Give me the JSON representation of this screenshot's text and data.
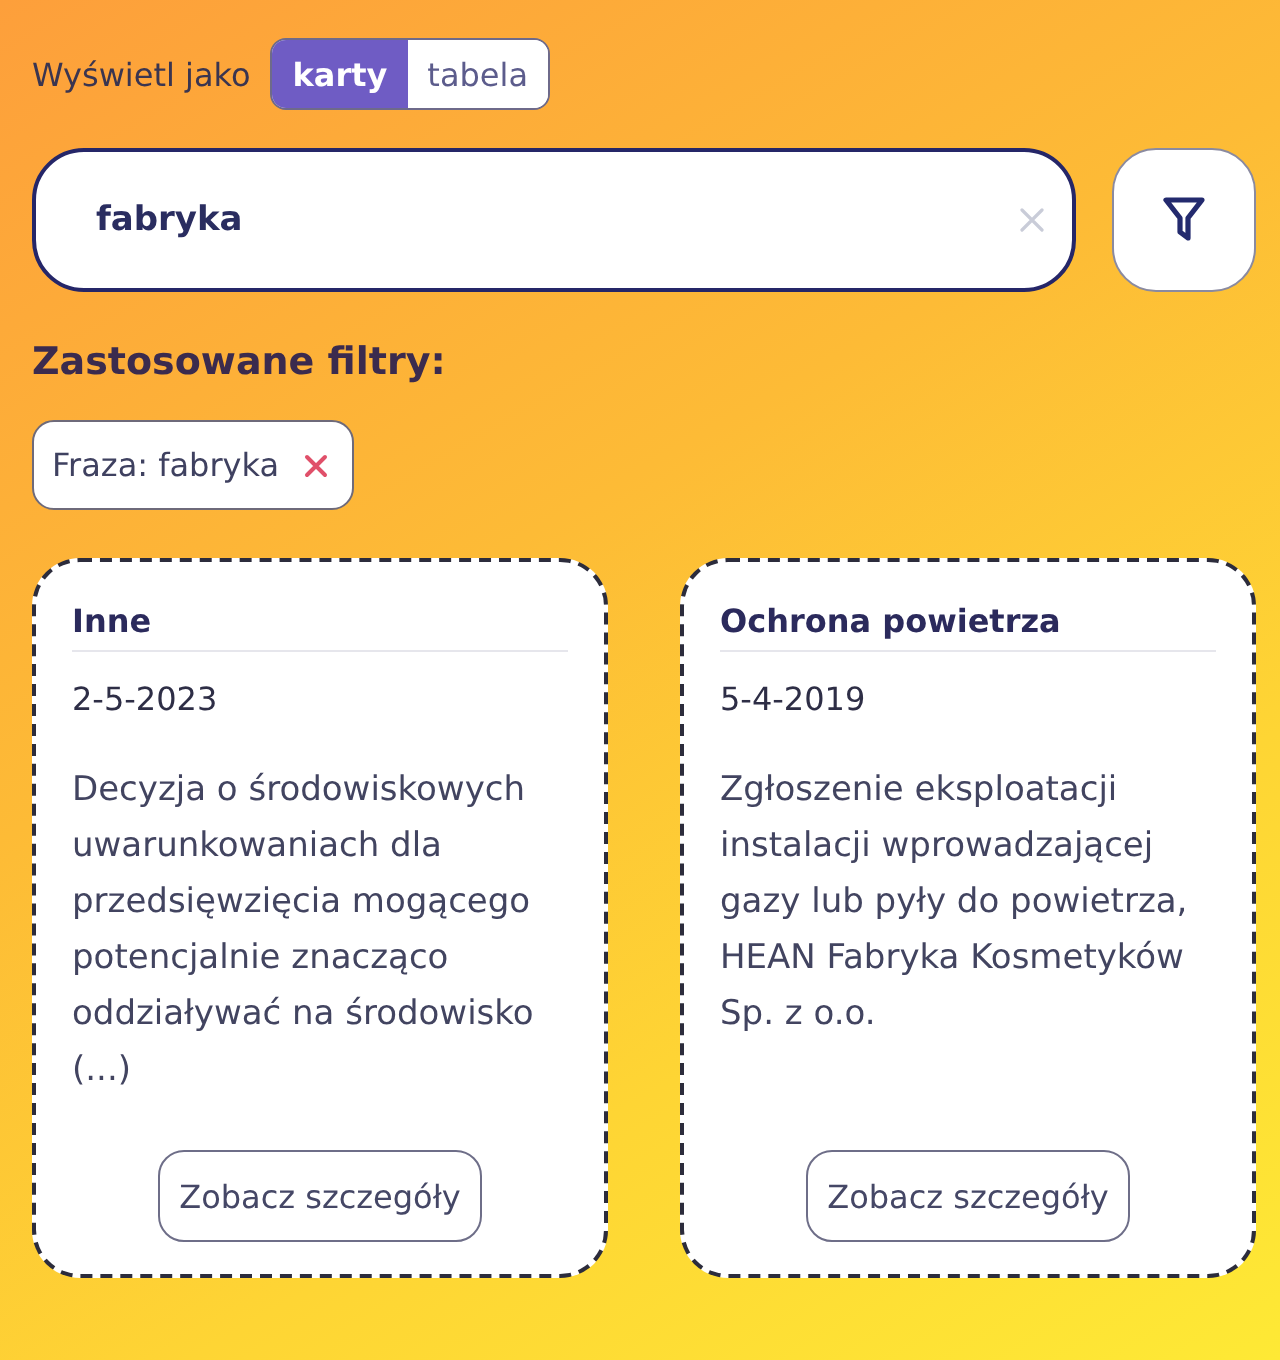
{
  "view_toggle": {
    "label": "Wyświetl jako",
    "options": [
      {
        "label": "karty",
        "selected": true
      },
      {
        "label": "tabela",
        "selected": false
      }
    ]
  },
  "search": {
    "value": "fabryka"
  },
  "applied_filters": {
    "title": "Zastosowane filtry:",
    "chips": [
      {
        "label": "Fraza: fabryka"
      }
    ]
  },
  "cards": [
    {
      "category": "Inne",
      "date": "2-5-2023",
      "description": "Decyzja o środowiskowych uwarunkowaniach dla przedsięwzięcia mogącego potencjalnie znacząco oddziaływać na środowisko (...)",
      "button": "Zobacz szczegóły"
    },
    {
      "category": "Ochrona powietrza",
      "date": "5-4-2019",
      "description": "Zgłoszenie eksploatacji instalacji wprowadzającej gazy lub pyły do powietrza, HEAN Fabryka Kosmetyków Sp. z o.o.",
      "button": "Zobacz szczegóły"
    }
  ]
}
